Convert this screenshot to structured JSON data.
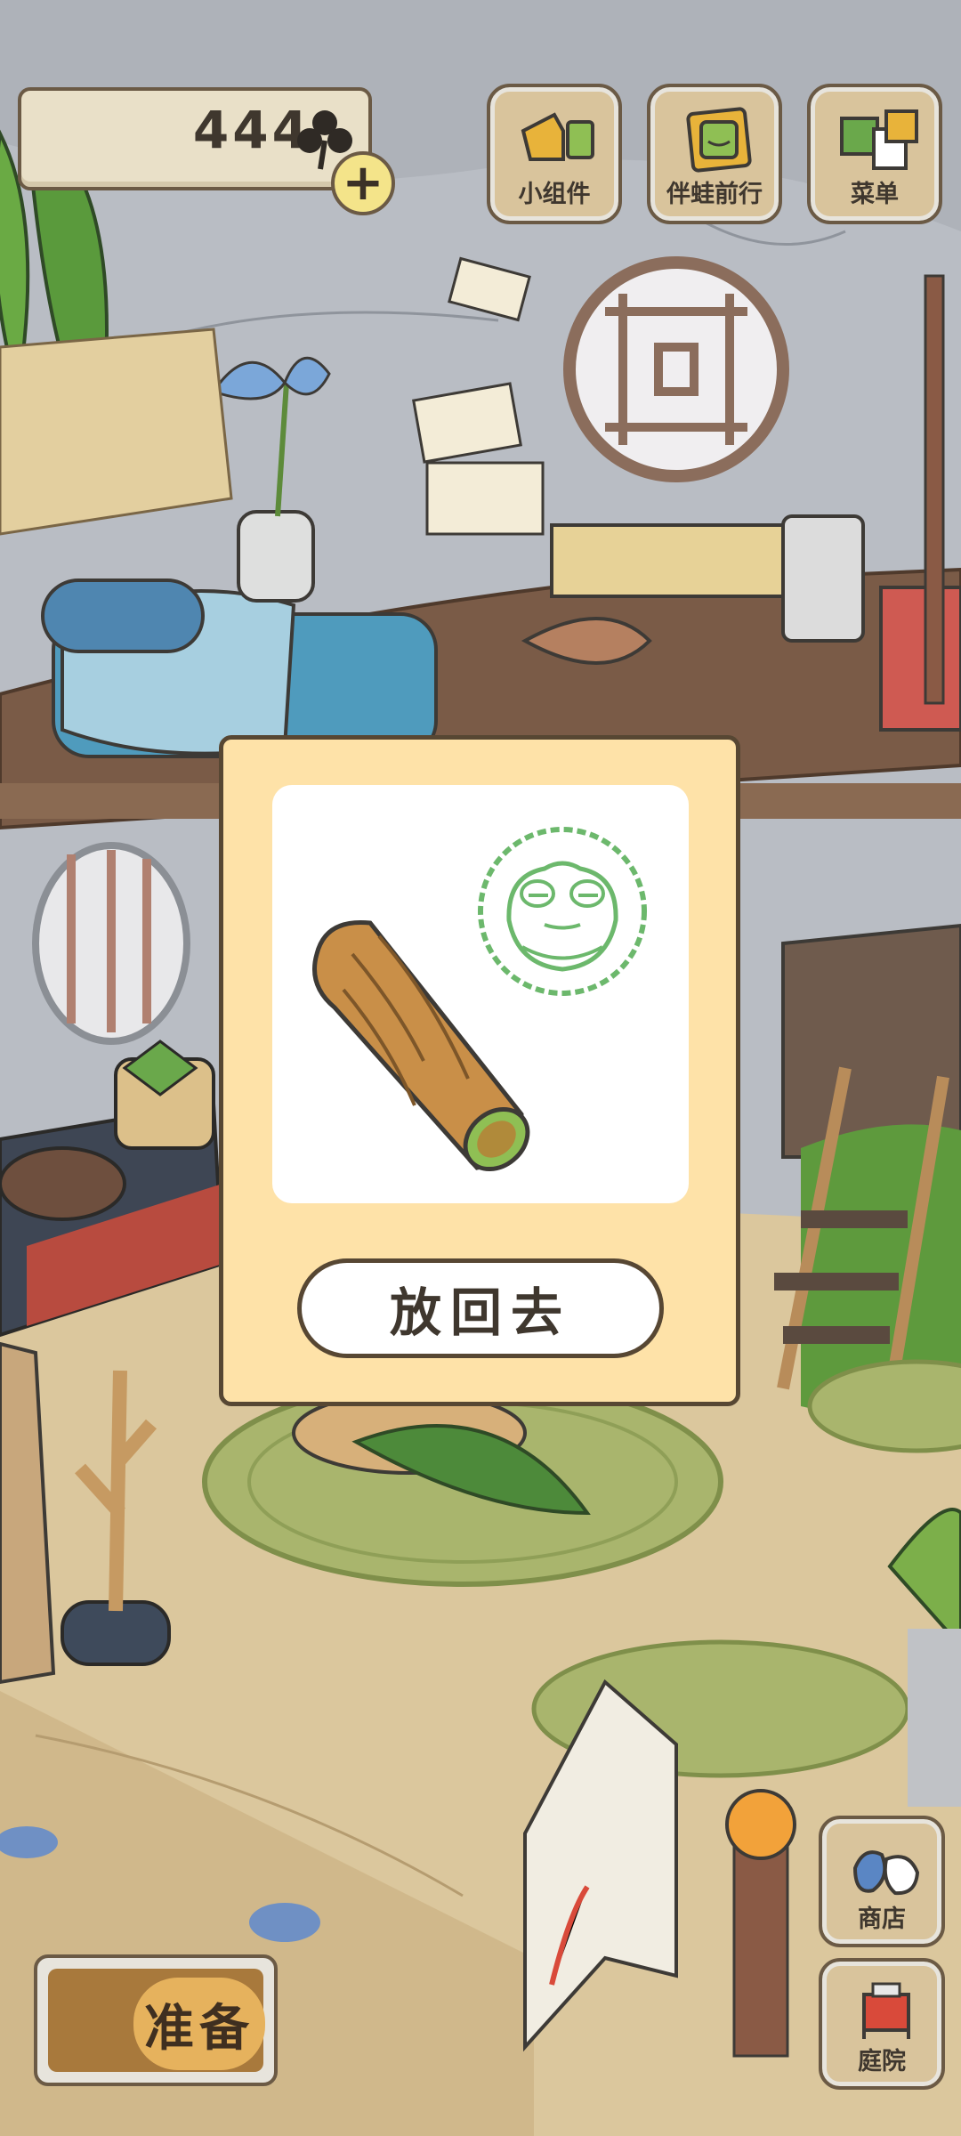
{
  "hud": {
    "clover_count": "444",
    "clover_icon": "clover-icon",
    "add_icon": "+"
  },
  "top_menu": [
    {
      "label": "小组件",
      "icon": "widget-icon"
    },
    {
      "label": "伴蛙前行",
      "icon": "frog-companion-icon"
    },
    {
      "label": "菜单",
      "icon": "menu-icon"
    }
  ],
  "modal": {
    "item_icon": "wooden-log-icon",
    "stamp_icon": "frog-stamp-icon",
    "put_back_label": "放回去"
  },
  "bottom": {
    "prepare_label": "准备",
    "shop_label": "商店",
    "garden_label": "庭院"
  },
  "colors": {
    "modal_bg": "#fee2a8",
    "button_wood": "#d9c49c",
    "outline": "#574733",
    "stamp_green": "#5aa85a"
  }
}
